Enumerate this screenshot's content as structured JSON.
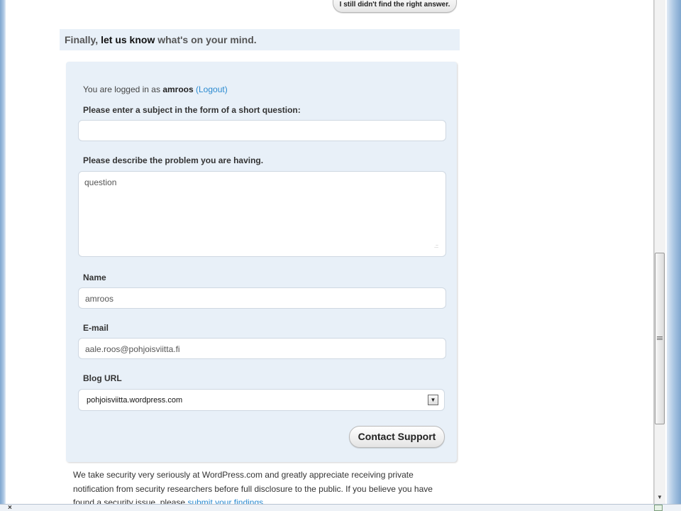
{
  "top_button": {
    "label": "I still didn't find the right answer."
  },
  "heading": {
    "part1": "Finally, ",
    "part2": "let us know",
    "part3": " what's on your mind."
  },
  "form": {
    "logged_in_prefix": "You are logged in as ",
    "username": "amroos",
    "logout_label": "(Logout)",
    "subject_label": "Please enter a subject in the form of a short question:",
    "subject_value": "",
    "description_label": "Please describe the problem you are having.",
    "description_placeholder": "question",
    "name_label": "Name",
    "name_value": "amroos",
    "email_label": "E-mail",
    "email_value": "aale.roos@pohjoisviitta.fi",
    "blog_label": "Blog URL",
    "blog_selected": "pohjoisviitta.wordpress.com",
    "submit_label": "Contact Support"
  },
  "footer_text": {
    "text": "We take security very seriously at WordPress.com and greatly appreciate receiving private notification from security researchers before full disclosure to the public. If you believe you have found a security issue, please ",
    "link": "submit your findings"
  },
  "status_bar": {
    "close_glyph": "×"
  },
  "colors": {
    "panel_bg": "#e8f0f8",
    "link": "#2a8ad0",
    "text": "#333333"
  }
}
